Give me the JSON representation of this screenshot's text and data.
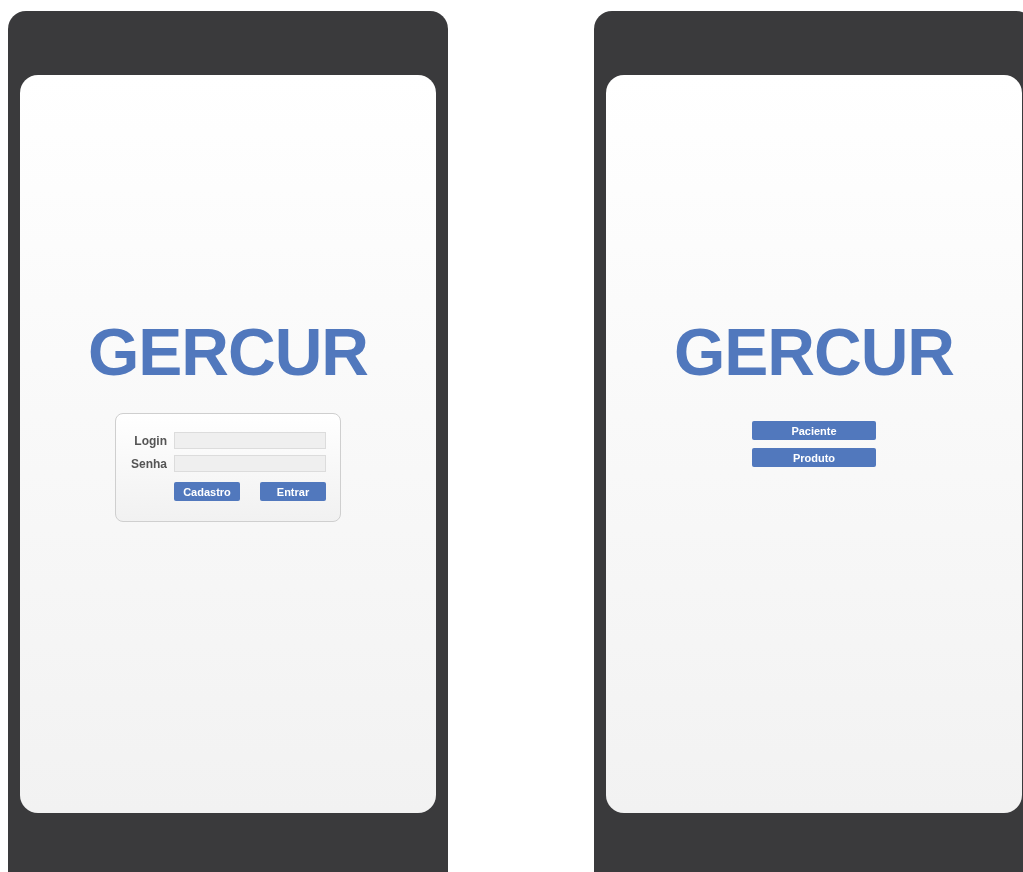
{
  "phones": [
    {
      "kind": "login",
      "title": "GERCUR",
      "fields": [
        {
          "label": "Login"
        },
        {
          "label": "Senha"
        }
      ],
      "buttons": [
        "Cadastro",
        "Entrar"
      ]
    },
    {
      "kind": "menu",
      "title": "GERCUR",
      "buttons": [
        "Paciente",
        "Produto"
      ]
    }
  ]
}
